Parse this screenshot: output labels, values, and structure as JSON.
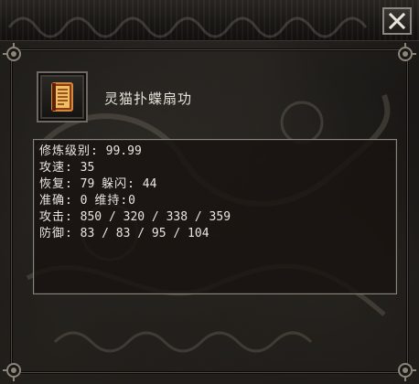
{
  "window": {
    "close_label": "×"
  },
  "skill": {
    "name": "灵猫扑蝶扇功",
    "icon": "book-icon"
  },
  "stats": {
    "level_label": "修炼级别:",
    "level_value": "99.99",
    "attack_speed_label": "攻速:",
    "attack_speed_value": "35",
    "recovery_label": "恢复:",
    "recovery_value": "79",
    "dodge_label": "躲闪:",
    "dodge_value": "44",
    "accuracy_label": "准确:",
    "accuracy_value": "0",
    "sustain_label": "维持:",
    "sustain_value": "0",
    "attack_label": "攻击:",
    "attack_value": "850 / 320 / 338 / 359",
    "defense_label": "防御:",
    "defense_value": "83 / 83 / 95 / 104"
  },
  "colors": {
    "text": "#e8e6e0",
    "border": "#8a857c",
    "panel_bg": "#1a1512"
  }
}
